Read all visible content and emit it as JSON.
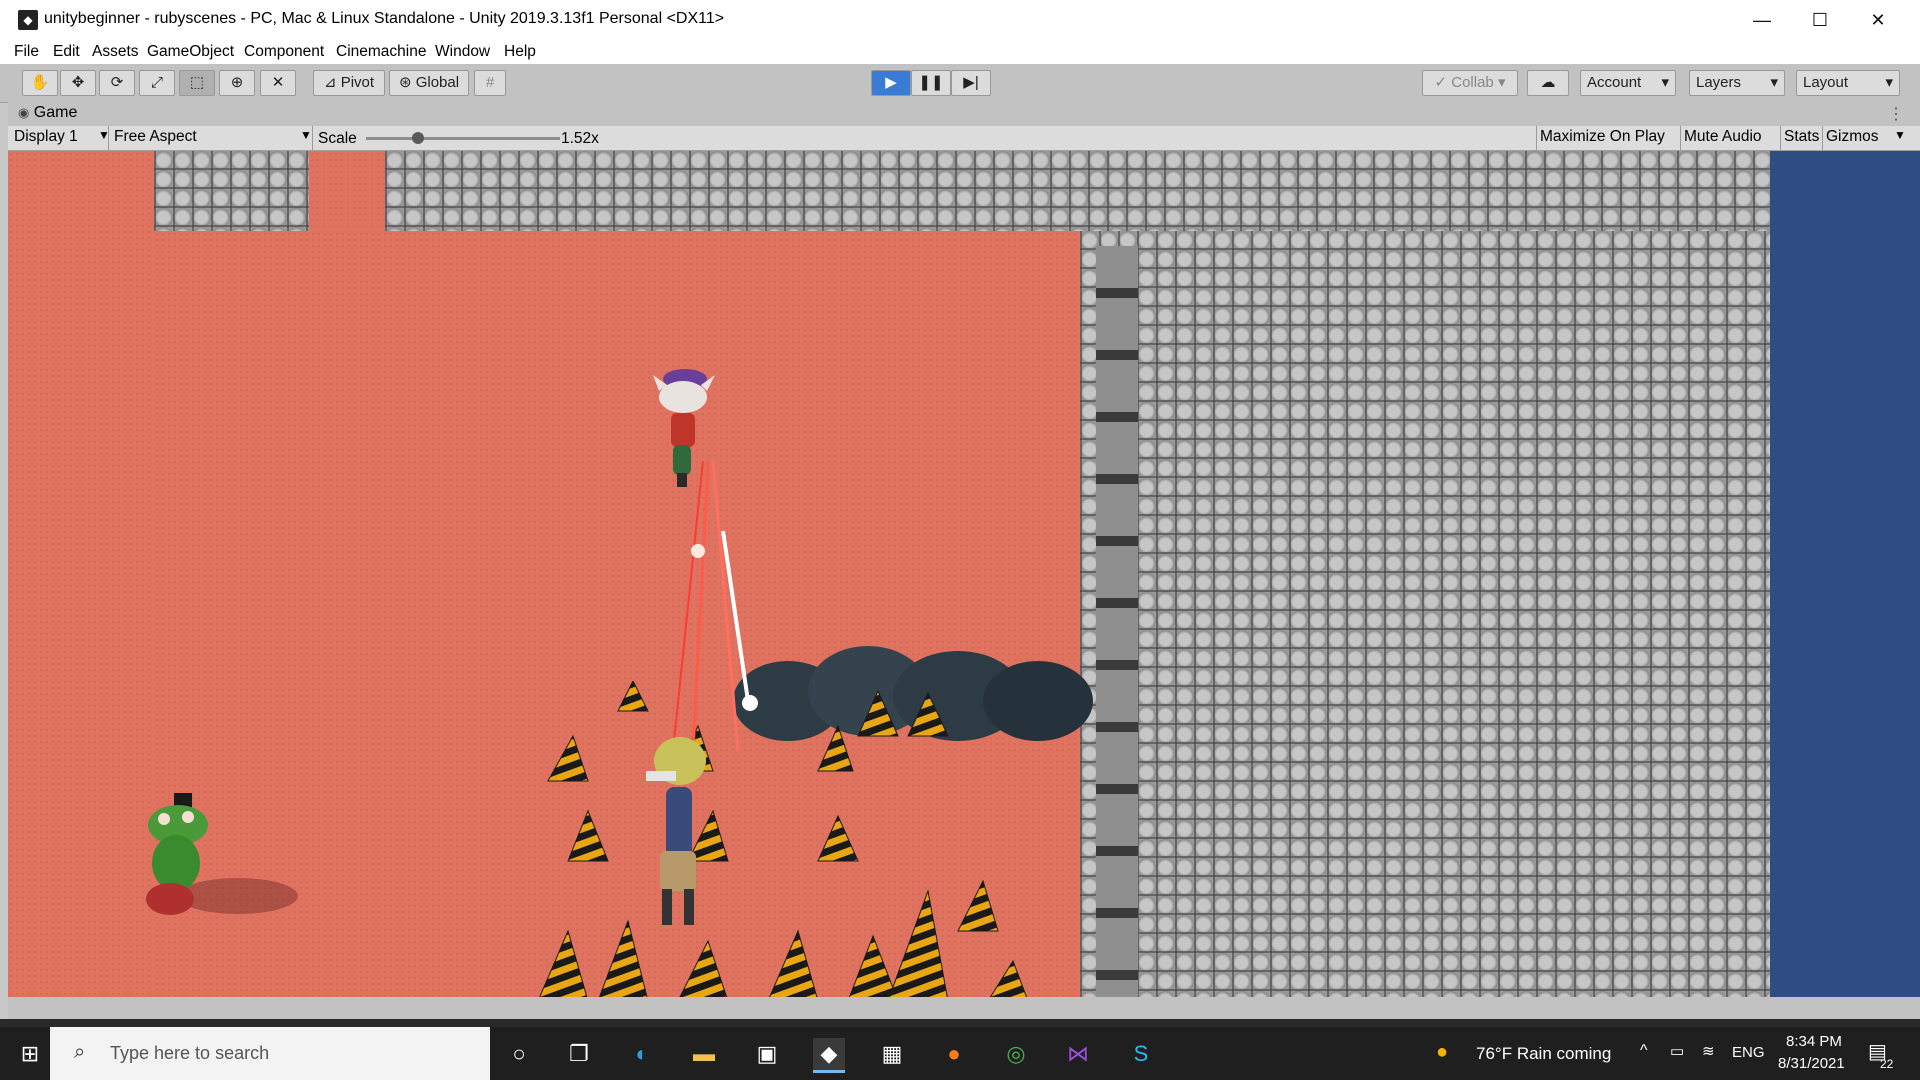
{
  "window": {
    "title": "unitybeginner - rubyscenes - PC, Mac & Linux Standalone - Unity 2019.3.13f1 Personal <DX11>",
    "minimize_glyph": "—",
    "maximize_glyph": "☐",
    "close_glyph": "✕"
  },
  "menu": [
    "File",
    "Edit",
    "Assets",
    "GameObject",
    "Component",
    "Cinemachine",
    "Window",
    "Help"
  ],
  "toolbar": {
    "tools": [
      "hand-tool",
      "move-tool",
      "rotate-tool",
      "scale-tool",
      "rect-tool",
      "transform-tool",
      "custom-tool"
    ],
    "pivot_label": "Pivot",
    "global_label": "Global",
    "collab_label": "Collab",
    "account_label": "Account",
    "layers_label": "Layers",
    "layout_label": "Layout",
    "play_state": "playing"
  },
  "game_view": {
    "tab_label": "Game",
    "display_label": "Display 1",
    "aspect_label": "Free Aspect",
    "scale_label": "Scale",
    "scale_value": "1.52x",
    "scale_fraction": 0.25,
    "maximize_on_play": "Maximize On Play",
    "mute_audio": "Mute Audio",
    "stats": "Stats",
    "gizmos": "Gizmos"
  },
  "taskbar": {
    "search_placeholder": "Type here to search",
    "apps": [
      "cortana",
      "task-view",
      "edge",
      "file-explorer",
      "store",
      "unity",
      "calendar",
      "firefox",
      "chrome",
      "visual-studio",
      "app-s"
    ],
    "weather": "76°F  Rain coming",
    "language": "ENG",
    "time": "8:34 PM",
    "date": "8/31/2021",
    "notification_count": "22"
  },
  "colors": {
    "floor": "#e07260",
    "stone": "#9a9a9a",
    "water": "#2f4d85",
    "play_blue": "#3a7bd5"
  }
}
